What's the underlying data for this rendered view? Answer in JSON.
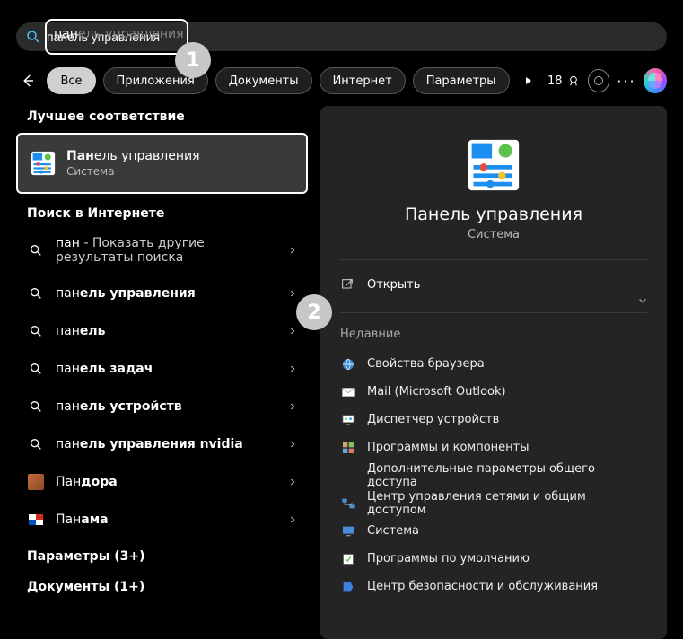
{
  "search": {
    "typed": "пан",
    "suggestion": "ель управления",
    "full_value": "панель управления"
  },
  "callouts": {
    "one": "1",
    "two": "2"
  },
  "filters": {
    "all": "Все",
    "apps": "Приложения",
    "docs": "Документы",
    "internet": "Интернет",
    "settings": "Параметры"
  },
  "rewards": {
    "points": "18"
  },
  "left": {
    "best_match_label": "Лучшее соответствие",
    "best_match": {
      "title_prefix": "Пан",
      "title_rest": "ель управления",
      "subtitle": "Система"
    },
    "web_label": "Поиск в Интернете",
    "items": [
      {
        "icon": "search",
        "prefix": "пан",
        "rest": " - Показать другие результаты поиска",
        "bold_rest": false,
        "multiline": true
      },
      {
        "icon": "search",
        "prefix": "пан",
        "rest": "ель управления",
        "bold_rest": true
      },
      {
        "icon": "search",
        "prefix": "пан",
        "rest": "ель",
        "bold_rest": true
      },
      {
        "icon": "search",
        "prefix": "пан",
        "rest": "ель задач",
        "bold_rest": true
      },
      {
        "icon": "search",
        "prefix": "пан",
        "rest": "ель устройств",
        "bold_rest": true
      },
      {
        "icon": "search",
        "prefix": "пан",
        "rest": "ель управления nvidia",
        "bold_rest": true
      },
      {
        "icon": "flag-pandora",
        "prefix": "Пан",
        "rest": "дора",
        "bold_rest": true
      },
      {
        "icon": "flag-panama",
        "prefix": "Пан",
        "rest": "ама",
        "bold_rest": true
      }
    ],
    "settings_group": "Параметры (3+)",
    "documents_group": "Документы (1+)"
  },
  "right": {
    "title": "Панель управления",
    "subtitle": "Система",
    "open_label": "Открыть",
    "recent_label": "Недавние",
    "recent": [
      {
        "icon": "browser-props",
        "label": "Свойства браузера"
      },
      {
        "icon": "mail",
        "label": "Mail (Microsoft Outlook)"
      },
      {
        "icon": "device-mgr",
        "label": "Диспетчер устройств"
      },
      {
        "icon": "programs",
        "label": "Программы и компоненты"
      },
      {
        "icon": "sharing",
        "label": "Дополнительные параметры общего доступа"
      },
      {
        "icon": "network",
        "label": "Центр управления сетями и общим доступом"
      },
      {
        "icon": "system",
        "label": "Система"
      },
      {
        "icon": "defaults",
        "label": "Программы по умолчанию"
      },
      {
        "icon": "security",
        "label": "Центр безопасности и обслуживания"
      }
    ]
  },
  "colors": {
    "cp_icon_bg": "#ffffff",
    "cp_icon_blue": "#1b8ef0",
    "cp_icon_green": "#5bc24a",
    "cp_icon_yellow": "#f6c22b",
    "cp_icon_red": "#e44d3c"
  }
}
